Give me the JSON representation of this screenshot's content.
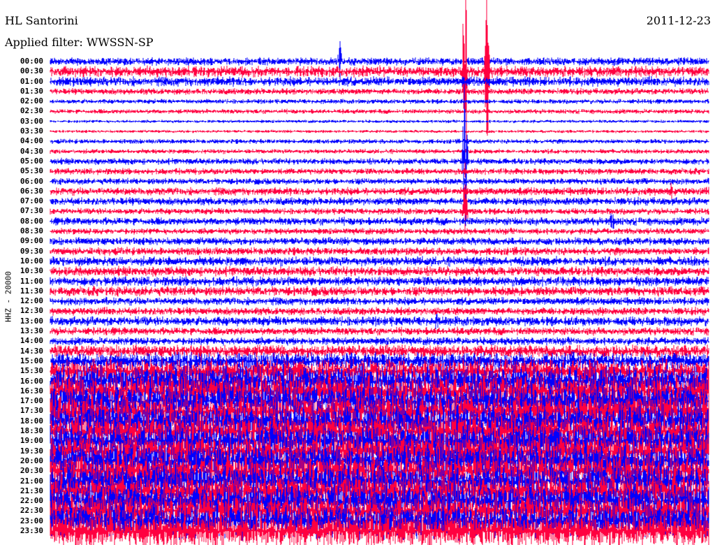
{
  "header": {
    "station": "HL Santorini",
    "date": "2011-12-23",
    "filter": "Applied filter: WWSSN-SP"
  },
  "chart_data": {
    "type": "line",
    "title": "HL Santorini",
    "subtitle": "Applied filter: WWSSN-SP",
    "ylabel": "HHZ - 20000",
    "xlabel": "",
    "row_minutes": 30,
    "row_labels": [
      "00:00",
      "00:30",
      "01:00",
      "01:30",
      "02:00",
      "02:30",
      "03:00",
      "03:30",
      "04:00",
      "04:30",
      "05:00",
      "05:30",
      "06:00",
      "06:30",
      "07:00",
      "07:30",
      "08:00",
      "08:30",
      "09:00",
      "09:30",
      "10:00",
      "10:30",
      "11:00",
      "11:30",
      "12:00",
      "12:30",
      "13:00",
      "13:30",
      "14:00",
      "14:30",
      "15:00",
      "15:30",
      "16:00",
      "16:30",
      "17:00",
      "17:30",
      "18:00",
      "18:30",
      "19:00",
      "19:30",
      "20:00",
      "20:30",
      "21:00",
      "21:30",
      "22:00",
      "22:30",
      "23:00",
      "23:30"
    ],
    "row_colors": [
      "#0000ff",
      "#ff0040"
    ],
    "relative_amplitude": [
      5,
      7,
      6,
      4,
      3,
      3,
      2,
      2,
      3,
      3,
      4,
      4,
      4,
      5,
      5,
      4,
      5,
      4,
      5,
      5,
      6,
      6,
      6,
      6,
      5,
      5,
      6,
      5,
      5,
      8,
      11,
      16,
      20,
      22,
      22,
      22,
      22,
      22,
      22,
      22,
      22,
      22,
      22,
      22,
      22,
      22,
      22,
      22
    ],
    "events": [
      {
        "row": "00:00",
        "minute": 13.2,
        "amplitude": 30
      },
      {
        "row": "00:30",
        "minute": 18.9,
        "amplitude": 200
      },
      {
        "row": "00:30",
        "minute": 19.9,
        "amplitude": 120
      },
      {
        "row": "05:00",
        "minute": 18.9,
        "amplitude": 150
      },
      {
        "row": "07:30",
        "minute": 18.9,
        "amplitude": 60
      },
      {
        "row": "08:00",
        "minute": 25.6,
        "amplitude": 20
      },
      {
        "row": "06:30",
        "minute": 28.3,
        "amplitude": 14
      },
      {
        "row": "13:00",
        "minute": 17.6,
        "amplitude": 14
      }
    ]
  }
}
